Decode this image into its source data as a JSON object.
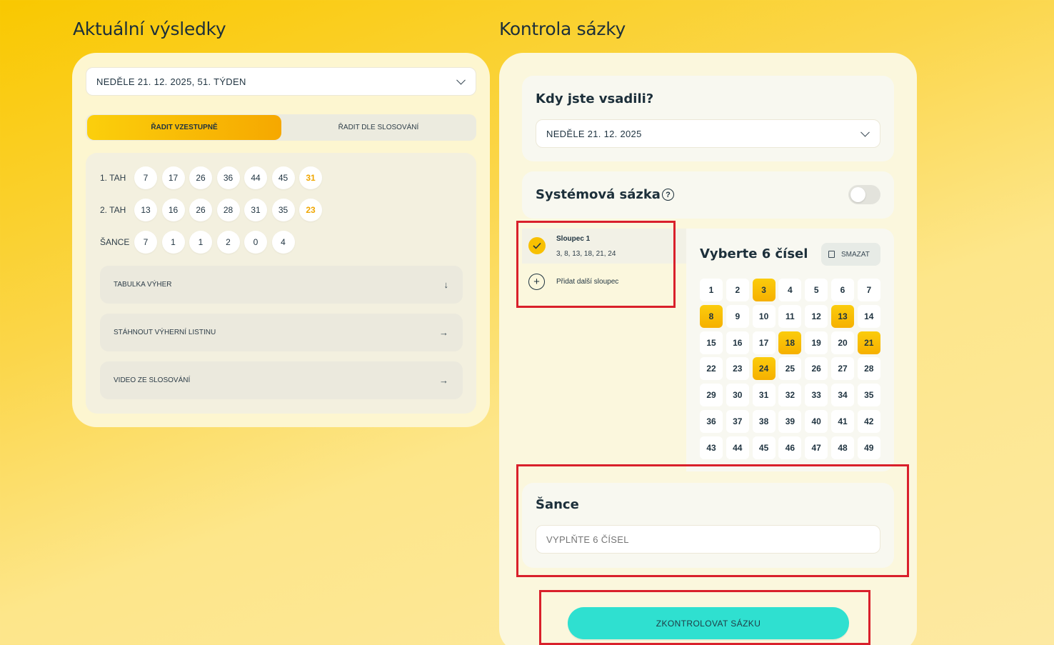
{
  "left": {
    "heading": "Aktuální výsledky",
    "date_select": "NEDĚLE 21. 12. 2025, 51. TÝDEN",
    "sort_active": "ŘADIT VZESTUPNĚ",
    "sort_inactive": "ŘADIT DLE SLOSOVÁNÍ",
    "rows": [
      {
        "label": "1. TAH",
        "numbers": [
          "7",
          "17",
          "26",
          "36",
          "44",
          "45"
        ],
        "bonus": "31"
      },
      {
        "label": "2. TAH",
        "numbers": [
          "13",
          "16",
          "26",
          "28",
          "31",
          "35"
        ],
        "bonus": "23"
      },
      {
        "label": "ŠANCE",
        "numbers": [
          "7",
          "1",
          "1",
          "2",
          "0",
          "4"
        ],
        "bonus": ""
      }
    ],
    "actions": [
      {
        "label": "TABULKA VÝHER",
        "icon": "arrow-down-icon",
        "glyph": "↓"
      },
      {
        "label": "STÁHNOUT VÝHERNÍ LISTINU",
        "icon": "arrow-right-icon",
        "glyph": "→"
      },
      {
        "label": "VIDEO ZE SLOSOVÁNÍ",
        "icon": "arrow-right-icon",
        "glyph": "→"
      }
    ]
  },
  "right": {
    "heading": "Kontrola sázky",
    "when_title": "Kdy jste vsadili?",
    "when_select": "NEDĚLE 21. 12. 2025",
    "system_title": "Systémová sázka",
    "system_toggle_on": false,
    "column": {
      "title": "Sloupec 1",
      "numbers": "3, 8, 13, 18, 21, 24"
    },
    "add_column": "Přidat další sloupec",
    "pick_title": "Vyberte 6 čísel",
    "clear_label": "SMAZAT",
    "grid": [
      "1",
      "2",
      "3",
      "4",
      "5",
      "6",
      "7",
      "8",
      "9",
      "10",
      "11",
      "12",
      "13",
      "14",
      "15",
      "16",
      "17",
      "18",
      "19",
      "20",
      "21",
      "22",
      "23",
      "24",
      "25",
      "26",
      "27",
      "28",
      "29",
      "30",
      "31",
      "32",
      "33",
      "34",
      "35",
      "36",
      "37",
      "38",
      "39",
      "40",
      "41",
      "42",
      "43",
      "44",
      "45",
      "46",
      "47",
      "48",
      "49"
    ],
    "selected": [
      "3",
      "8",
      "13",
      "18",
      "21",
      "24"
    ],
    "sance_title": "Šance",
    "sance_placeholder": "VYPLŇTE 6 ČÍSEL",
    "submit": "ZKONTROLOVAT SÁZKU"
  },
  "colors": {
    "accent": "#f6b000",
    "cta": "#2fe0d0",
    "highlight_box": "#d9202b"
  }
}
